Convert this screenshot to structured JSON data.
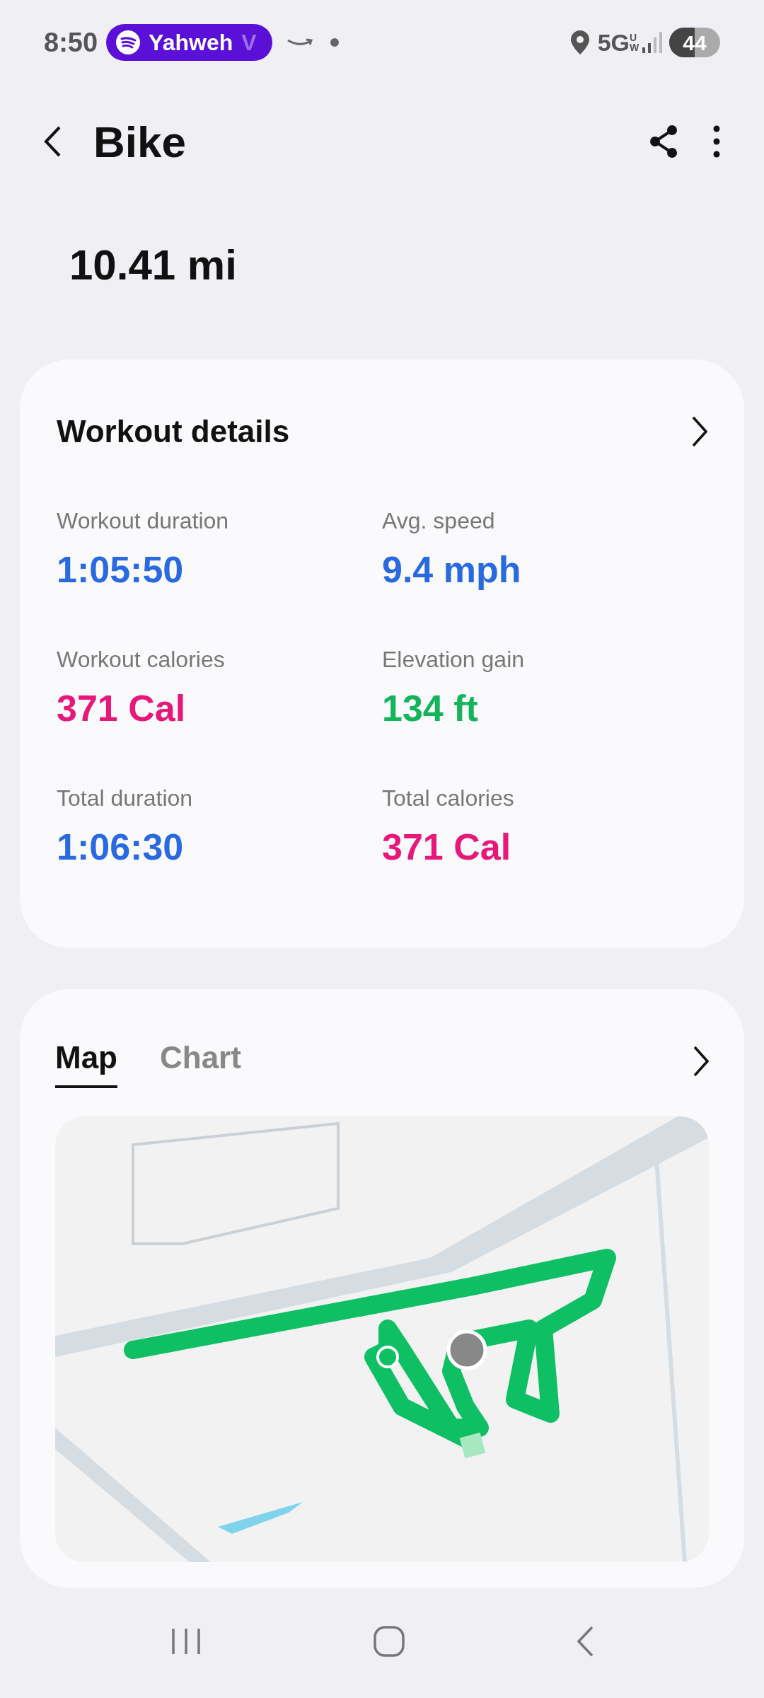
{
  "status_bar": {
    "time": "8:50",
    "media_pill": {
      "title": "Yahweh",
      "title_tail": "V"
    },
    "network": "5G",
    "network_sub": "UW",
    "battery": "44"
  },
  "header": {
    "title": "Bike"
  },
  "distance": "10.41 mi",
  "workout_details": {
    "title": "Workout details",
    "stats": [
      {
        "label": "Workout duration",
        "value": "1:05:50",
        "color": "#2a6ae0"
      },
      {
        "label": "Avg. speed",
        "value": "9.4 mph",
        "color": "#2a6ae0"
      },
      {
        "label": "Workout calories",
        "value": "371 Cal",
        "color": "#e8177a"
      },
      {
        "label": "Elevation gain",
        "value": "134 ft",
        "color": "#14b45a"
      },
      {
        "label": "Total duration",
        "value": "1:06:30",
        "color": "#2a6ae0"
      },
      {
        "label": "Total calories",
        "value": "371 Cal",
        "color": "#e8177a"
      }
    ]
  },
  "route": {
    "tabs": [
      {
        "label": "Map",
        "selected": true
      },
      {
        "label": "Chart",
        "selected": false
      }
    ]
  }
}
